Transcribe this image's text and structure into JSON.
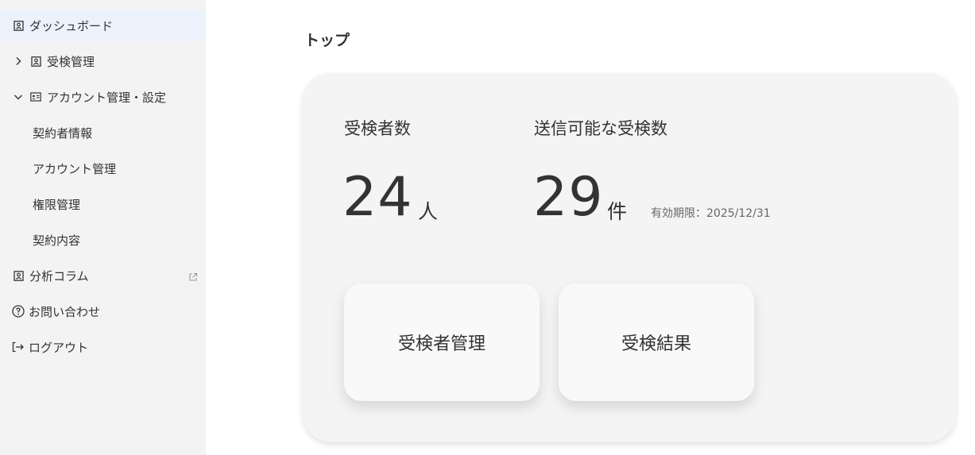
{
  "sidebar": {
    "dashboard": "ダッシュボード",
    "exam_mgmt": "受検管理",
    "account_settings": "アカウント管理・設定",
    "sub": {
      "contractor_info": "契約者情報",
      "account_mgmt": "アカウント管理",
      "permission_mgmt": "権限管理",
      "contract_details": "契約内容"
    },
    "analysis_column": "分析コラム",
    "contact": "お問い合わせ",
    "logout": "ログアウト"
  },
  "main": {
    "title": "トップ",
    "stats": {
      "examinees_label": "受検者数",
      "examinees_value": "24",
      "examinees_unit": "人",
      "sendable_label": "送信可能な受検数",
      "sendable_value": "29",
      "sendable_unit": "件",
      "expiry": "有効期限：2025/12/31"
    },
    "buttons": {
      "examinee_mgmt": "受検者管理",
      "exam_results": "受検結果"
    }
  },
  "colors": {
    "sidebar_bg": "#f3f3f3",
    "active_bg": "#ecf2fb",
    "card_bg": "#f4f4f4",
    "text": "#333333"
  }
}
